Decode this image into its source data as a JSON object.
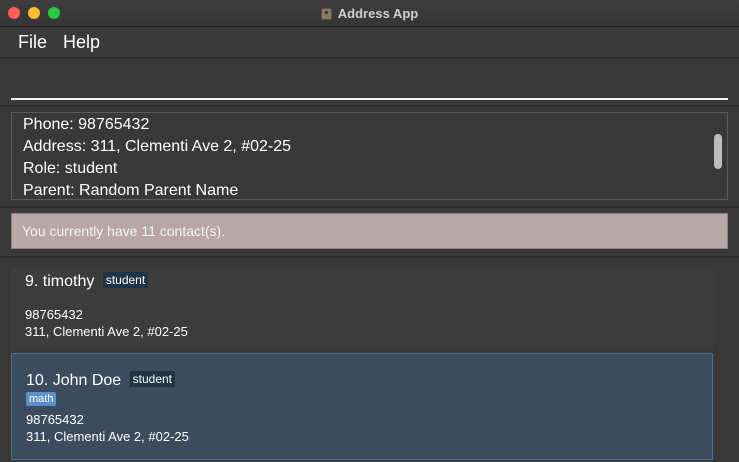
{
  "window": {
    "title": "Address App",
    "icon": "address-book-icon"
  },
  "menu": {
    "file": "File",
    "help": "Help"
  },
  "command": {
    "value": "",
    "placeholder": ""
  },
  "result": {
    "lines": [
      "Phone: 98765432",
      "Address: 311, Clementi Ave 2, #02-25",
      "Role: student",
      "Parent: Random Parent Name"
    ]
  },
  "status": {
    "text": "You currently have 11 contact(s)."
  },
  "contacts": [
    {
      "index": "9.",
      "name": "timothy",
      "role": "student",
      "phone": "98765432",
      "address": "311, Clementi Ave 2, #02-25",
      "tags": [],
      "selected": false
    },
    {
      "index": "10.",
      "name": "John Doe",
      "role": "student",
      "tag": "math",
      "phone": "98765432",
      "address": "311, Clementi Ave 2, #02-25",
      "selected": true
    }
  ],
  "colors": {
    "background": "#2b2b2b",
    "panel": "#383838",
    "status_bar": "#b8a7a8",
    "selected_card": "#3d4b5e",
    "role_badge": "#1f3445",
    "tag_badge": "#5b8fc9"
  }
}
